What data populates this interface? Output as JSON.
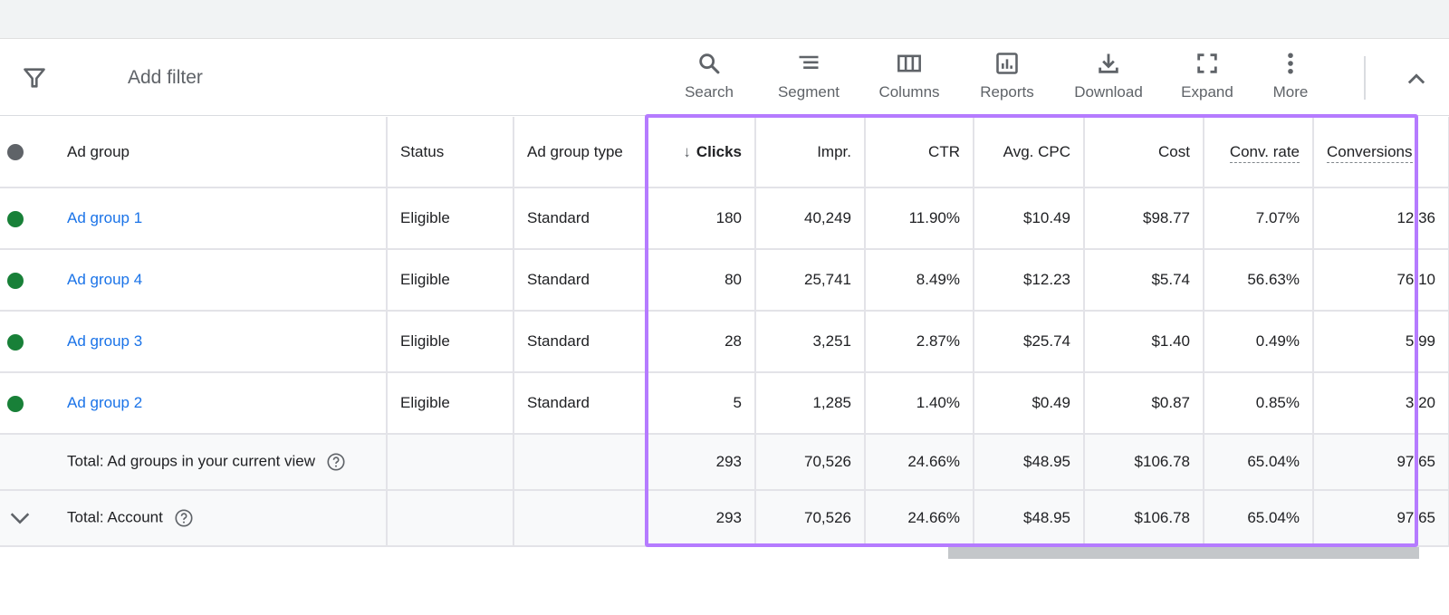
{
  "toolbar": {
    "add_filter_label": "Add filter",
    "tools": [
      {
        "id": "search",
        "label": "Search",
        "icon": "search-icon"
      },
      {
        "id": "segment",
        "label": "Segment",
        "icon": "segment-icon"
      },
      {
        "id": "columns",
        "label": "Columns",
        "icon": "columns-icon"
      },
      {
        "id": "reports",
        "label": "Reports",
        "icon": "reports-icon"
      },
      {
        "id": "download",
        "label": "Download",
        "icon": "download-icon"
      },
      {
        "id": "expand",
        "label": "Expand",
        "icon": "expand-icon"
      },
      {
        "id": "more",
        "label": "More",
        "icon": "more-vert-icon"
      }
    ],
    "collapse_icon": "chevron-up-icon"
  },
  "table": {
    "columns": [
      "",
      "Ad group",
      "Status",
      "Ad group type",
      "Clicks",
      "Impr.",
      "CTR",
      "Avg. CPC",
      "Cost",
      "Conv. rate",
      "Conversions"
    ],
    "sorted_column": "Clicks",
    "sort_direction": "descending",
    "rows": [
      {
        "status_color": "#188038",
        "ad_group": "Ad group 1",
        "status": "Eligible",
        "type": "Standard",
        "clicks": "180",
        "impr": "40,249",
        "ctr": "11.90%",
        "avg_cpc": "$10.49",
        "cost": "$98.77",
        "conv_rate": "7.07%",
        "conversions": "12.36"
      },
      {
        "status_color": "#188038",
        "ad_group": "Ad group 4",
        "status": "Eligible",
        "type": "Standard",
        "clicks": "80",
        "impr": "25,741",
        "ctr": "8.49%",
        "avg_cpc": "$12.23",
        "cost": "$5.74",
        "conv_rate": "56.63%",
        "conversions": "76.10"
      },
      {
        "status_color": "#188038",
        "ad_group": "Ad group 3",
        "status": "Eligible",
        "type": "Standard",
        "clicks": "28",
        "impr": "3,251",
        "ctr": "2.87%",
        "avg_cpc": "$25.74",
        "cost": "$1.40",
        "conv_rate": "0.49%",
        "conversions": "5.99"
      },
      {
        "status_color": "#188038",
        "ad_group": "Ad group 2",
        "status": "Eligible",
        "type": "Standard",
        "clicks": "5",
        "impr": "1,285",
        "ctr": "1.40%",
        "avg_cpc": "$0.49",
        "cost": "$0.87",
        "conv_rate": "0.85%",
        "conversions": "3.20"
      }
    ],
    "totals": [
      {
        "label": "Total: Ad groups in your current view",
        "clicks": "293",
        "impr": "70,526",
        "ctr": "24.66%",
        "avg_cpc": "$48.95",
        "cost": "$106.78",
        "conv_rate": "65.04%",
        "conversions": "97.65"
      },
      {
        "label": "Total: Account",
        "clicks": "293",
        "impr": "70,526",
        "ctr": "24.66%",
        "avg_cpc": "$48.95",
        "cost": "$106.78",
        "conv_rate": "65.04%",
        "conversions": "97.65"
      }
    ]
  },
  "colors": {
    "header_dot": "#5f6368",
    "eligible": "#188038",
    "link": "#1a73e8",
    "highlight_border": "#b57bff"
  }
}
